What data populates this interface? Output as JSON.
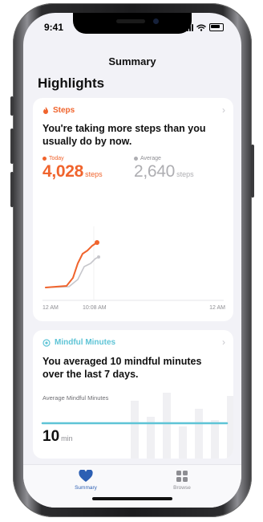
{
  "status_bar": {
    "time": "9:41"
  },
  "nav": {
    "title": "Summary"
  },
  "highlights": {
    "title": "Highlights"
  },
  "steps_card": {
    "title": "Steps",
    "message": "You're taking more steps than you usually do by now.",
    "today_label": "Today",
    "today_value": "4,028",
    "today_unit": "steps",
    "average_label": "Average",
    "average_value": "2,640",
    "average_unit": "steps",
    "x_labels": [
      "12 AM",
      "10:08 AM",
      "12 AM"
    ],
    "accent_color": "#f0642d",
    "average_color": "#aeaeb2"
  },
  "mindful_card": {
    "title": "Mindful Minutes",
    "message": "You averaged 10 mindful minutes over the last 7 days.",
    "average_label": "Average Mindful Minutes",
    "value": "10",
    "unit": "min",
    "accent_color": "#5ec4d6"
  },
  "tab_bar": {
    "tabs": [
      {
        "label": "Summary",
        "icon": "heart-icon",
        "selected": true
      },
      {
        "label": "Browse",
        "icon": "grid-icon",
        "selected": false
      }
    ]
  }
}
